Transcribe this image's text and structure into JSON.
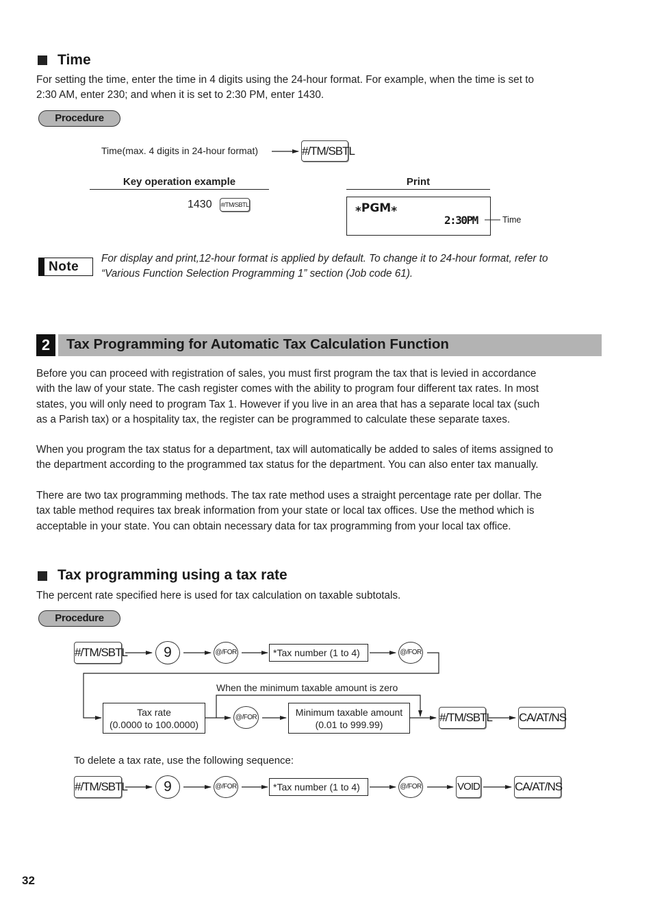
{
  "time_section": {
    "heading": "Time",
    "intro": "For setting the time, enter the time in 4 digits using the 24-hour format.  For example, when the time is set to 2:30 AM, enter 230; and when it is set to 2:30 PM, enter 1430.",
    "intro_line1": "For setting the time, enter the time in 4 digits using the 24-hour format.  For example, when the time is set to",
    "intro_line2": "2:30 AM, enter 230; and when it is set to 2:30 PM, enter 1430.",
    "procedure_label": "Procedure",
    "procedure_input_label": "Time(max. 4 digits in 24-hour format)",
    "procedure_key": "#/TM/SBTL",
    "key_operation_header": "Key operation example",
    "key_operation_value": "1430",
    "key_operation_key": "#/TM/SBTL",
    "print_header": "Print",
    "print_line1": "⁎PGM⁎",
    "print_line2": "2:30PM",
    "print_callout": "Time"
  },
  "note": {
    "badge": "Note",
    "line1": "For display and print,12-hour format is applied by default.  To change it to 24-hour format, refer to",
    "line2": "“Various Function Selection Programming 1” section (Job code 61)."
  },
  "tax_section": {
    "number": "2",
    "title": "Tax Programming for Automatic Tax Calculation Function",
    "paragraphs": [
      {
        "lines": [
          "Before you can proceed with registration of sales, you must first program the tax that is levied in accordance",
          "with the law of your state.  The cash register comes with the ability to program four different tax rates.  In most",
          "states, you will only need to program Tax 1.  However if you live in an area that has a separate local tax (such",
          "as a Parish tax) or a hospitality tax, the register can be programmed to calculate these separate taxes."
        ]
      },
      {
        "lines": [
          "When you program the tax status for a department, tax will automatically be added to sales of items assigned to",
          "the department according to the programmed tax status for the department.  You can also enter tax manually."
        ]
      },
      {
        "lines": [
          "There are two tax programming methods.  The tax rate method uses a straight percentage rate per dollar.  The",
          "tax table method requires tax break information from your state or local tax offices.  Use the method which is",
          "acceptable in your state.  You can obtain necessary data for tax programming from your local tax office."
        ]
      }
    ]
  },
  "tax_rate_section": {
    "heading": "Tax programming using a tax rate",
    "intro": "The percent rate specified here is used for tax calculation on taxable subtotals.",
    "procedure_label": "Procedure",
    "flow": {
      "key_sbtl": "#/TM/SBTL",
      "key_9": "9",
      "key_for": "@/FOR",
      "tax_number_box": "*Tax number (1 to 4)",
      "tax_rate_line1": "Tax rate",
      "tax_rate_line2": "(0.0000 to 100.0000)",
      "bypass_label": "When the minimum taxable amount is zero",
      "min_amount_line1": "Minimum taxable amount",
      "min_amount_line2": "(0.01 to 999.99)",
      "key_ca": "CA/AT/NS"
    },
    "delete_intro": "To delete a tax rate, use the following sequence:",
    "delete_flow": {
      "key_sbtl": "#/TM/SBTL",
      "key_9": "9",
      "key_for": "@/FOR",
      "tax_number_box": "*Tax number (1 to 4)",
      "key_void": "VOID",
      "key_ca": "CA/AT/NS"
    }
  },
  "footer": {
    "page_number": "32"
  }
}
